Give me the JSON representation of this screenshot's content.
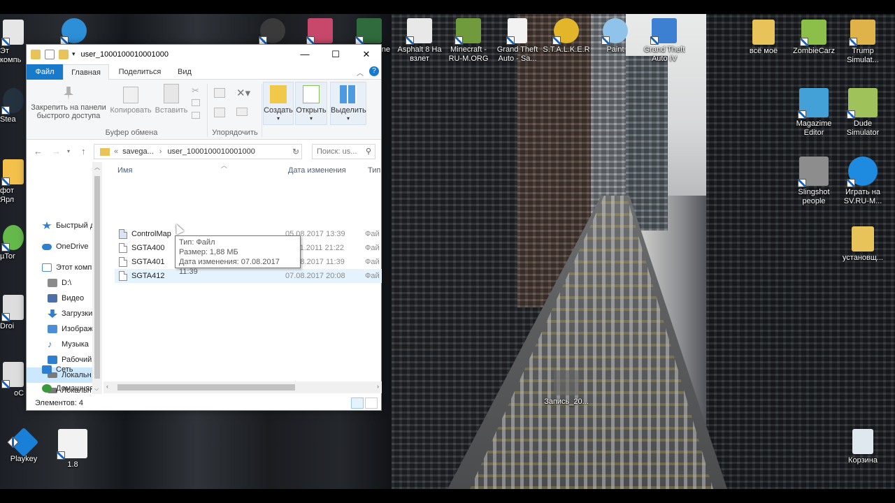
{
  "desktop": {
    "icons_left_partial": [
      {
        "label": "Эт компь",
        "icon": "this-pc-icon",
        "color": "#e6e6e6"
      },
      {
        "label": "Stea",
        "icon": "steam-icon",
        "color": "#24323f"
      },
      {
        "label": "фот Ярл",
        "icon": "photo-shortcut-icon",
        "color": "#f3c04c"
      },
      {
        "label": "µTor",
        "icon": "utorrent-icon",
        "color": "#64b94a"
      },
      {
        "label": "Droi",
        "icon": "droid-icon",
        "color": "#dddddd"
      },
      {
        "label": "oC",
        "icon": "oc-icon",
        "color": "#dddddd"
      }
    ],
    "icons_top": [
      {
        "label": "",
        "icon": "settings-gear-icon",
        "color": "#2d8fd8"
      },
      {
        "label": "",
        "icon": "crossed-tools-icon",
        "color": "#3a3a3a"
      },
      {
        "label": "",
        "icon": "candy-game-icon",
        "color": "#c8486b"
      },
      {
        "label": "ne",
        "icon": "game-emblem-icon",
        "color": "#2f6b3c"
      },
      {
        "label": "Asphalt 8 На взлет",
        "icon": "asphalt-icon",
        "color": "#e8e8e8"
      },
      {
        "label": "Minecraft - RU-M.ORG",
        "icon": "minecraft-icon",
        "color": "#6f9b3d"
      },
      {
        "label": "Grand Theft Auto - Sa...",
        "icon": "blank-file-icon",
        "color": "#f2f2f2"
      },
      {
        "label": "S.T.A.L.K.E.R",
        "icon": "radiation-icon",
        "color": "#e3b52a"
      },
      {
        "label": "Paint",
        "icon": "paint-palette-icon",
        "color": "#8fc3e9"
      },
      {
        "label": "Grand Theft Auto IV",
        "icon": "window-app-icon",
        "color": "#3d7fd1"
      }
    ],
    "icons_right": [
      {
        "label": "всё моё",
        "icon": "folder-icon",
        "color": "#e8c35a"
      },
      {
        "label": "ZombieCarz",
        "icon": "zombie-icon",
        "color": "#8bbf4a"
      },
      {
        "label": "Trump Simulat...",
        "icon": "trump-icon",
        "color": "#e0b24a"
      },
      {
        "label": "Magazime Editor",
        "icon": "avatar-face-icon",
        "color": "#43a1d8"
      },
      {
        "label": "Dude Simulator",
        "icon": "dude-sim-icon",
        "color": "#9fc25a"
      },
      {
        "label": "Slingshot people",
        "icon": "slingshot-icon",
        "color": "#8d8d8d"
      },
      {
        "label": "Играть на SV.RU-M...",
        "icon": "sv-s-icon",
        "color": "#1f8be0"
      },
      {
        "label": "установщ...",
        "icon": "folder-installer-icon",
        "color": "#e8c35a"
      }
    ],
    "icons_bottom": [
      {
        "label": "Playkey",
        "icon": "playkey-icon",
        "color": "#1a7fd6"
      },
      {
        "label": "1.8",
        "icon": "java-cup-icon",
        "color": "#f2f2f2"
      },
      {
        "label": "Запись_20...",
        "icon": "recording-icon",
        "color": "#666666"
      },
      {
        "label": "Корзина",
        "icon": "recycle-bin-icon",
        "color": "#dfe8ef"
      }
    ]
  },
  "explorer": {
    "title": "user_1000100010001000",
    "window_controls": {
      "minimize": "—",
      "maximize": "☐",
      "close": "✕"
    },
    "tabs": [
      "Файл",
      "Главная",
      "Поделиться",
      "Вид"
    ],
    "ribbon": {
      "pin_label": "Закрепить на панели быстрого доступа",
      "copy_label": "Копировать",
      "paste_label": "Вставить",
      "clipboard_group": "Буфер обмена",
      "organize_group": "Упорядочить",
      "create_label": "Создать",
      "open_label": "Открыть",
      "select_label": "Выделить"
    },
    "address": {
      "prefix": "«",
      "crumb1": "savega...",
      "sep": "›",
      "crumb2": "user_1000100010001000"
    },
    "search_placeholder": "Поиск: us...",
    "nav": [
      {
        "label": "Быстрый д",
        "icon": "star-icon",
        "color": "#2f7fd0"
      },
      {
        "label": "OneDrive",
        "icon": "onedrive-cloud-icon",
        "color": "#2f7fd0"
      },
      {
        "label": "Этот комп",
        "icon": "this-pc-icon",
        "color": "#4c8fd6"
      },
      {
        "label": "D:\\",
        "icon": "drive-icon",
        "color": "#8b8b8b"
      },
      {
        "label": "Видео",
        "icon": "video-icon",
        "color": "#4c6fa8"
      },
      {
        "label": "Загрузки",
        "icon": "download-arrow-icon",
        "color": "#2f7fd0"
      },
      {
        "label": "Изображ",
        "icon": "pictures-icon",
        "color": "#4c8fd6"
      },
      {
        "label": "Музыка",
        "icon": "music-note-icon",
        "color": "#2f7fd0"
      },
      {
        "label": "Рабочий",
        "icon": "desktop-icon",
        "color": "#2f7fd0"
      },
      {
        "label": "Локальн",
        "icon": "local-disk-icon",
        "color": "#7a7a7a"
      },
      {
        "label": "Локальн",
        "icon": "local-disk-icon",
        "color": "#7a7a7a"
      },
      {
        "label": "Сеть",
        "icon": "network-icon",
        "color": "#2f7fd0"
      },
      {
        "label": "Домашняя",
        "icon": "homegroup-icon",
        "color": "#3a9a3a"
      }
    ],
    "columns": {
      "name": "Имя",
      "date": "Дата изменения",
      "type": "Тип"
    },
    "files": [
      {
        "name": "ControlMap",
        "date": "05.08.2017 13:39",
        "type": "Фай",
        "icon": "document-icon"
      },
      {
        "name": "SGTA400",
        "date": "17.11.2011 21:22",
        "type": "Фай",
        "icon": "file-icon"
      },
      {
        "name": "SGTA401",
        "date": "07.08.2017 11:39",
        "type": "Фай",
        "icon": "file-icon"
      },
      {
        "name": "SGTA412",
        "date": "07.08.2017 20:08",
        "type": "Фай",
        "icon": "file-icon"
      }
    ],
    "tooltip": {
      "type_line": "Тип: Файл",
      "size_line": "Размер: 1,88 МБ",
      "date_line": "Дата изменения: 07.08.2017 11:39"
    },
    "status": "Элементов: 4"
  }
}
